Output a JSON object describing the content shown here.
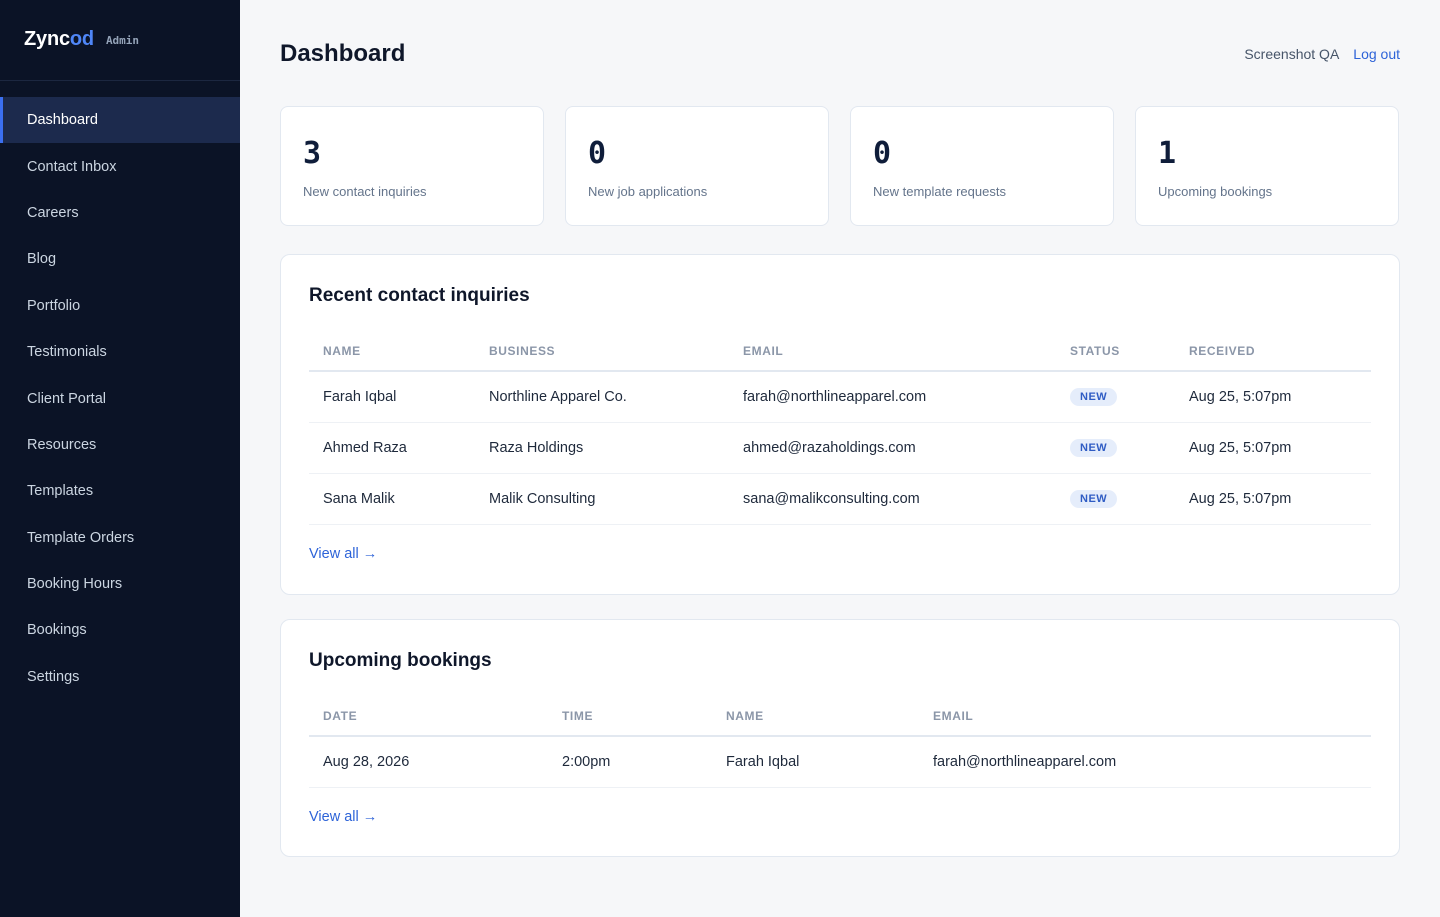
{
  "brand": {
    "name_a": "Zync",
    "name_b": "od",
    "tag": "Admin",
    "accent": "#4f86f7"
  },
  "sidebar": {
    "items": [
      {
        "label": "Dashboard",
        "active": true
      },
      {
        "label": "Contact Inbox"
      },
      {
        "label": "Careers"
      },
      {
        "label": "Blog"
      },
      {
        "label": "Portfolio"
      },
      {
        "label": "Testimonials"
      },
      {
        "label": "Client Portal"
      },
      {
        "label": "Resources"
      },
      {
        "label": "Templates"
      },
      {
        "label": "Template Orders"
      },
      {
        "label": "Booking Hours"
      },
      {
        "label": "Bookings"
      },
      {
        "label": "Settings"
      }
    ]
  },
  "header": {
    "title": "Dashboard",
    "user": "Screenshot QA",
    "logout": "Log out"
  },
  "stats": [
    {
      "value": "3",
      "label": "New contact inquiries"
    },
    {
      "value": "0",
      "label": "New job applications"
    },
    {
      "value": "0",
      "label": "New template requests"
    },
    {
      "value": "1",
      "label": "Upcoming bookings"
    }
  ],
  "inquiries": {
    "title": "Recent contact inquiries",
    "columns": [
      "Name",
      "Business",
      "Email",
      "Status",
      "Received"
    ],
    "rows": [
      {
        "name": "Farah Iqbal",
        "business": "Northline Apparel Co.",
        "email": "farah@northlineapparel.com",
        "status": "NEW",
        "received": "Aug 25, 5:07pm"
      },
      {
        "name": "Ahmed Raza",
        "business": "Raza Holdings",
        "email": "ahmed@razaholdings.com",
        "status": "NEW",
        "received": "Aug 25, 5:07pm"
      },
      {
        "name": "Sana Malik",
        "business": "Malik Consulting",
        "email": "sana@malikconsulting.com",
        "status": "NEW",
        "received": "Aug 25, 5:07pm"
      }
    ],
    "view_all": "View all →"
  },
  "bookings": {
    "title": "Upcoming bookings",
    "columns": [
      "Date",
      "Time",
      "Name",
      "Email"
    ],
    "rows": [
      {
        "date": "Aug 28, 2026",
        "time": "2:00pm",
        "name": "Farah Iqbal",
        "email": "farah@northlineapparel.com"
      }
    ],
    "view_all": "View all →"
  },
  "colors": {
    "sidebar_bg": "#0b1326",
    "active_bg": "#1c2a4d",
    "link": "#2d63d8",
    "badge_bg": "#e5edfb"
  }
}
